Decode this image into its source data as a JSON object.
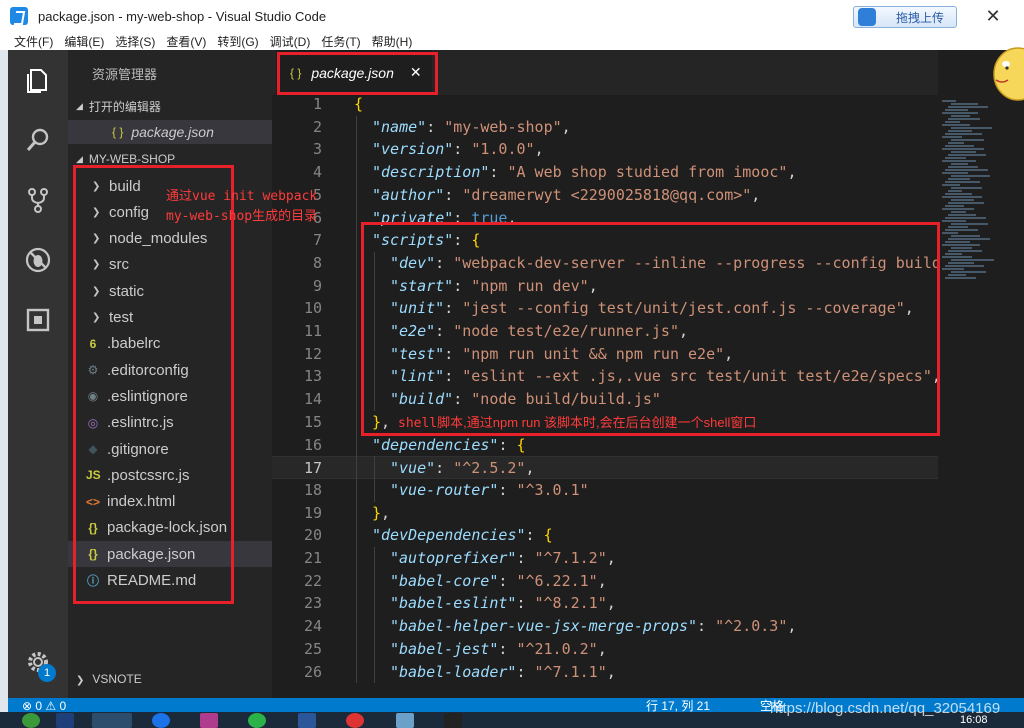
{
  "window": {
    "title": "package.json - my-web-shop - Visual Studio Code",
    "upload_label": "拖拽上传",
    "close_glyph": "✕"
  },
  "menu": [
    "文件(F)",
    "编辑(E)",
    "选择(S)",
    "查看(V)",
    "转到(G)",
    "调试(D)",
    "任务(T)",
    "帮助(H)"
  ],
  "sidebar": {
    "title": "资源管理器",
    "open_editors_label": "打开的编辑器",
    "open_editor_file": "package.json",
    "project_label": "MY-WEB-SHOP",
    "items": [
      {
        "label": "build",
        "type": "folder",
        "icon": "chevron-right-icon"
      },
      {
        "label": "config",
        "type": "folder",
        "icon": "chevron-right-icon"
      },
      {
        "label": "node_modules",
        "type": "folder",
        "icon": "chevron-right-icon"
      },
      {
        "label": "src",
        "type": "folder",
        "icon": "chevron-right-icon"
      },
      {
        "label": "static",
        "type": "folder",
        "icon": "chevron-right-icon"
      },
      {
        "label": "test",
        "type": "folder",
        "icon": "chevron-right-icon"
      },
      {
        "label": ".babelrc",
        "type": "file",
        "icon": "babel-icon",
        "glyph": "6",
        "color": "#cbcb41"
      },
      {
        "label": ".editorconfig",
        "type": "file",
        "icon": "gear-icon",
        "glyph": "⚙",
        "color": "#6d8086"
      },
      {
        "label": ".eslintignore",
        "type": "file",
        "icon": "circle-icon",
        "glyph": "◉",
        "color": "#6d8086"
      },
      {
        "label": ".eslintrc.js",
        "type": "file",
        "icon": "eslint-icon",
        "glyph": "◎",
        "color": "#a074c4"
      },
      {
        "label": ".gitignore",
        "type": "file",
        "icon": "git-icon",
        "glyph": "◆",
        "color": "#41535b"
      },
      {
        "label": ".postcssrc.js",
        "type": "file",
        "icon": "js-icon",
        "glyph": "JS",
        "color": "#cbcb41"
      },
      {
        "label": "index.html",
        "type": "file",
        "icon": "html-icon",
        "glyph": "<>",
        "color": "#e37933"
      },
      {
        "label": "package-lock.json",
        "type": "file",
        "icon": "json-icon",
        "glyph": "{}",
        "color": "#cbcb41"
      },
      {
        "label": "package.json",
        "type": "file",
        "icon": "json-icon",
        "glyph": "{}",
        "color": "#cbcb41",
        "selected": true
      },
      {
        "label": "README.md",
        "type": "file",
        "icon": "info-icon",
        "glyph": "ⓘ",
        "color": "#519aba"
      }
    ],
    "bottom_section": "VSNOTE",
    "badge_count": "1"
  },
  "editor": {
    "tab_label": "package.json",
    "tab_close": "✕",
    "current_line": 17,
    "lines": [
      {
        "n": 1,
        "indent": 0,
        "parts": [
          [
            "b",
            "{"
          ]
        ]
      },
      {
        "n": 2,
        "indent": 1,
        "parts": [
          [
            "k",
            "\"name\""
          ],
          [
            "p",
            ": "
          ],
          [
            "s",
            "\"my-web-shop\""
          ],
          [
            "p",
            ","
          ]
        ]
      },
      {
        "n": 3,
        "indent": 1,
        "parts": [
          [
            "k",
            "\"version\""
          ],
          [
            "p",
            ": "
          ],
          [
            "s",
            "\"1.0.0\""
          ],
          [
            "p",
            ","
          ]
        ]
      },
      {
        "n": 4,
        "indent": 1,
        "parts": [
          [
            "k",
            "\"description\""
          ],
          [
            "p",
            ": "
          ],
          [
            "s",
            "\"A web shop studied from imooc\""
          ],
          [
            "p",
            ","
          ]
        ]
      },
      {
        "n": 5,
        "indent": 1,
        "parts": [
          [
            "k",
            "\"author\""
          ],
          [
            "p",
            ": "
          ],
          [
            "s",
            "\"dreamerwyt <2290025818@qq.com>\""
          ],
          [
            "p",
            ","
          ]
        ]
      },
      {
        "n": 6,
        "indent": 1,
        "parts": [
          [
            "k",
            "\"private\""
          ],
          [
            "p",
            ": "
          ],
          [
            "kw",
            "true"
          ],
          [
            "p",
            ","
          ]
        ]
      },
      {
        "n": 7,
        "indent": 1,
        "parts": [
          [
            "k",
            "\"scripts\""
          ],
          [
            "p",
            ": "
          ],
          [
            "b",
            "{"
          ]
        ]
      },
      {
        "n": 8,
        "indent": 2,
        "parts": [
          [
            "k",
            "\"dev\""
          ],
          [
            "p",
            ": "
          ],
          [
            "s",
            "\"webpack-dev-server --inline --progress --config build/webpack.dev.conf.js\""
          ],
          [
            "p",
            ","
          ]
        ]
      },
      {
        "n": 9,
        "indent": 2,
        "parts": [
          [
            "k",
            "\"start\""
          ],
          [
            "p",
            ": "
          ],
          [
            "s",
            "\"npm run dev\""
          ],
          [
            "p",
            ","
          ]
        ]
      },
      {
        "n": 10,
        "indent": 2,
        "parts": [
          [
            "k",
            "\"unit\""
          ],
          [
            "p",
            ": "
          ],
          [
            "s",
            "\"jest --config test/unit/jest.conf.js --coverage\""
          ],
          [
            "p",
            ","
          ]
        ]
      },
      {
        "n": 11,
        "indent": 2,
        "parts": [
          [
            "k",
            "\"e2e\""
          ],
          [
            "p",
            ": "
          ],
          [
            "s",
            "\"node test/e2e/runner.js\""
          ],
          [
            "p",
            ","
          ]
        ]
      },
      {
        "n": 12,
        "indent": 2,
        "parts": [
          [
            "k",
            "\"test\""
          ],
          [
            "p",
            ": "
          ],
          [
            "s",
            "\"npm run unit && npm run e2e\""
          ],
          [
            "p",
            ","
          ]
        ]
      },
      {
        "n": 13,
        "indent": 2,
        "parts": [
          [
            "k",
            "\"lint\""
          ],
          [
            "p",
            ": "
          ],
          [
            "s",
            "\"eslint --ext .js,.vue src test/unit test/e2e/specs\""
          ],
          [
            "p",
            ","
          ]
        ]
      },
      {
        "n": 14,
        "indent": 2,
        "parts": [
          [
            "k",
            "\"build\""
          ],
          [
            "p",
            ": "
          ],
          [
            "s",
            "\"node build/build.js\""
          ]
        ]
      },
      {
        "n": 15,
        "indent": 1,
        "parts": [
          [
            "b",
            "}"
          ],
          [
            "p",
            ","
          ]
        ]
      },
      {
        "n": 16,
        "indent": 1,
        "parts": [
          [
            "k",
            "\"dependencies\""
          ],
          [
            "p",
            ": "
          ],
          [
            "b",
            "{"
          ]
        ]
      },
      {
        "n": 17,
        "indent": 2,
        "parts": [
          [
            "k",
            "\"vue\""
          ],
          [
            "p",
            ": "
          ],
          [
            "s",
            "\"^2.5.2\""
          ],
          [
            "p",
            ","
          ]
        ]
      },
      {
        "n": 18,
        "indent": 2,
        "parts": [
          [
            "k",
            "\"vue-router\""
          ],
          [
            "p",
            ": "
          ],
          [
            "s",
            "\"^3.0.1\""
          ]
        ]
      },
      {
        "n": 19,
        "indent": 1,
        "parts": [
          [
            "b",
            "}"
          ],
          [
            "p",
            ","
          ]
        ]
      },
      {
        "n": 20,
        "indent": 1,
        "parts": [
          [
            "k",
            "\"devDependencies\""
          ],
          [
            "p",
            ": "
          ],
          [
            "b",
            "{"
          ]
        ]
      },
      {
        "n": 21,
        "indent": 2,
        "parts": [
          [
            "k",
            "\"autoprefixer\""
          ],
          [
            "p",
            ": "
          ],
          [
            "s",
            "\"^7.1.2\""
          ],
          [
            "p",
            ","
          ]
        ]
      },
      {
        "n": 22,
        "indent": 2,
        "parts": [
          [
            "k",
            "\"babel-core\""
          ],
          [
            "p",
            ": "
          ],
          [
            "s",
            "\"^6.22.1\""
          ],
          [
            "p",
            ","
          ]
        ]
      },
      {
        "n": 23,
        "indent": 2,
        "parts": [
          [
            "k",
            "\"babel-eslint\""
          ],
          [
            "p",
            ": "
          ],
          [
            "s",
            "\"^8.2.1\""
          ],
          [
            "p",
            ","
          ]
        ]
      },
      {
        "n": 24,
        "indent": 2,
        "parts": [
          [
            "k",
            "\"babel-helper-vue-jsx-merge-props\""
          ],
          [
            "p",
            ": "
          ],
          [
            "s",
            "\"^2.0.3\""
          ],
          [
            "p",
            ","
          ]
        ]
      },
      {
        "n": 25,
        "indent": 2,
        "parts": [
          [
            "k",
            "\"babel-jest\""
          ],
          [
            "p",
            ": "
          ],
          [
            "s",
            "\"^21.0.2\""
          ],
          [
            "p",
            ","
          ]
        ]
      },
      {
        "n": 26,
        "indent": 2,
        "parts": [
          [
            "k",
            "\"babel-loader\""
          ],
          [
            "p",
            ": "
          ],
          [
            "s",
            "\"^7.1.1\""
          ],
          [
            "p",
            ","
          ]
        ]
      }
    ]
  },
  "annotations": {
    "folder_note_line1": "通过vue init webpack",
    "folder_note_line2": "my-web-shop生成的目录",
    "script_note_prefix": "shell脚本",
    "script_note_text": ",通过npm run 该脚本时,会在后台创建一个shell窗口"
  },
  "statusbar": {
    "errors": "⊗ 0",
    "warnings": "⚠ 0",
    "position": "行 17, 列 21",
    "spaces": "空格"
  },
  "watermark": "https://blog.csdn.net/qq_32054169",
  "clock": "16:08",
  "colors": {
    "accent": "#007acc",
    "annotation_red": "#e8202a",
    "editor_bg": "#1e1e1e",
    "sidebar_bg": "#252526"
  }
}
